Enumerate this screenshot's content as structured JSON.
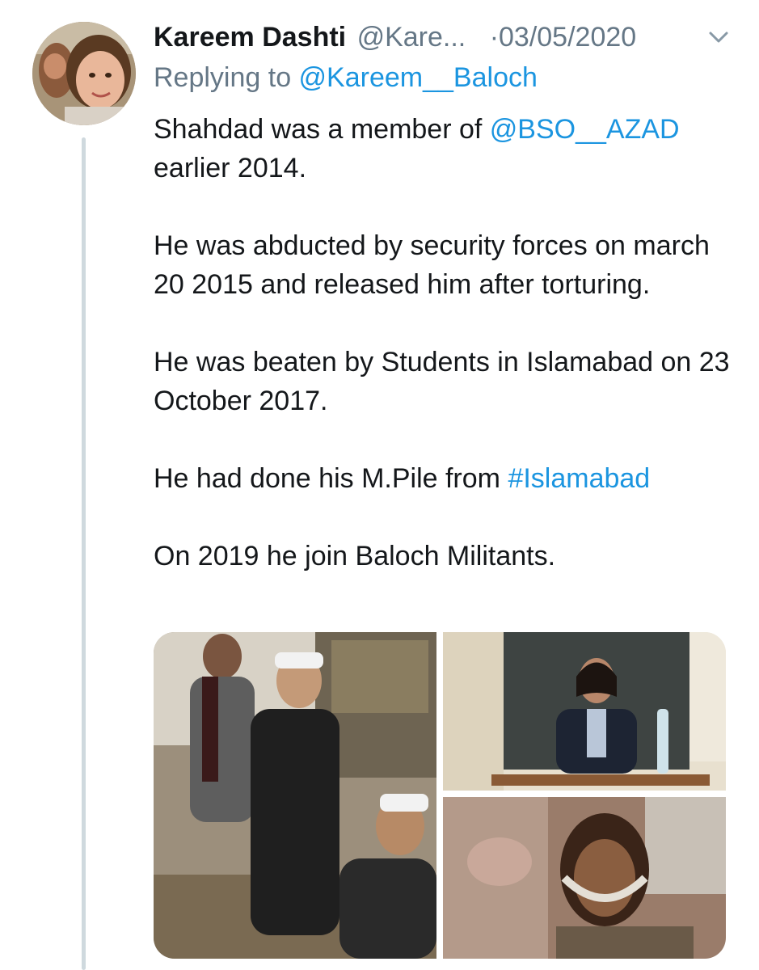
{
  "tweet": {
    "author": {
      "display_name": "Kareem Dashti",
      "handle": "@Kare..."
    },
    "date": "·03/05/2020",
    "reply": {
      "prefix": "Replying to ",
      "target": "@Kareem__Baloch"
    },
    "body": {
      "p1_a": "Shahdad was a member of ",
      "p1_mention": "@BSO__AZAD",
      "p1_b": " earlier 2014.",
      "p2": "He was abducted by security forces on march 20 2015 and released him after torturing.",
      "p3": "He was beaten by Students in Islamabad on 23 October 2017.",
      "p4_a": "He had done his M.Pile from ",
      "p4_hashtag": "#Islamabad",
      "p5": "On 2019 he join Baloch Militants."
    },
    "media_count": 3
  },
  "icons": {
    "more_menu": "chevron-down-icon"
  },
  "colors": {
    "link": "#1b95e0",
    "secondary_text": "#657786",
    "primary_text": "#14171a",
    "thread_line": "#cfd9de"
  }
}
